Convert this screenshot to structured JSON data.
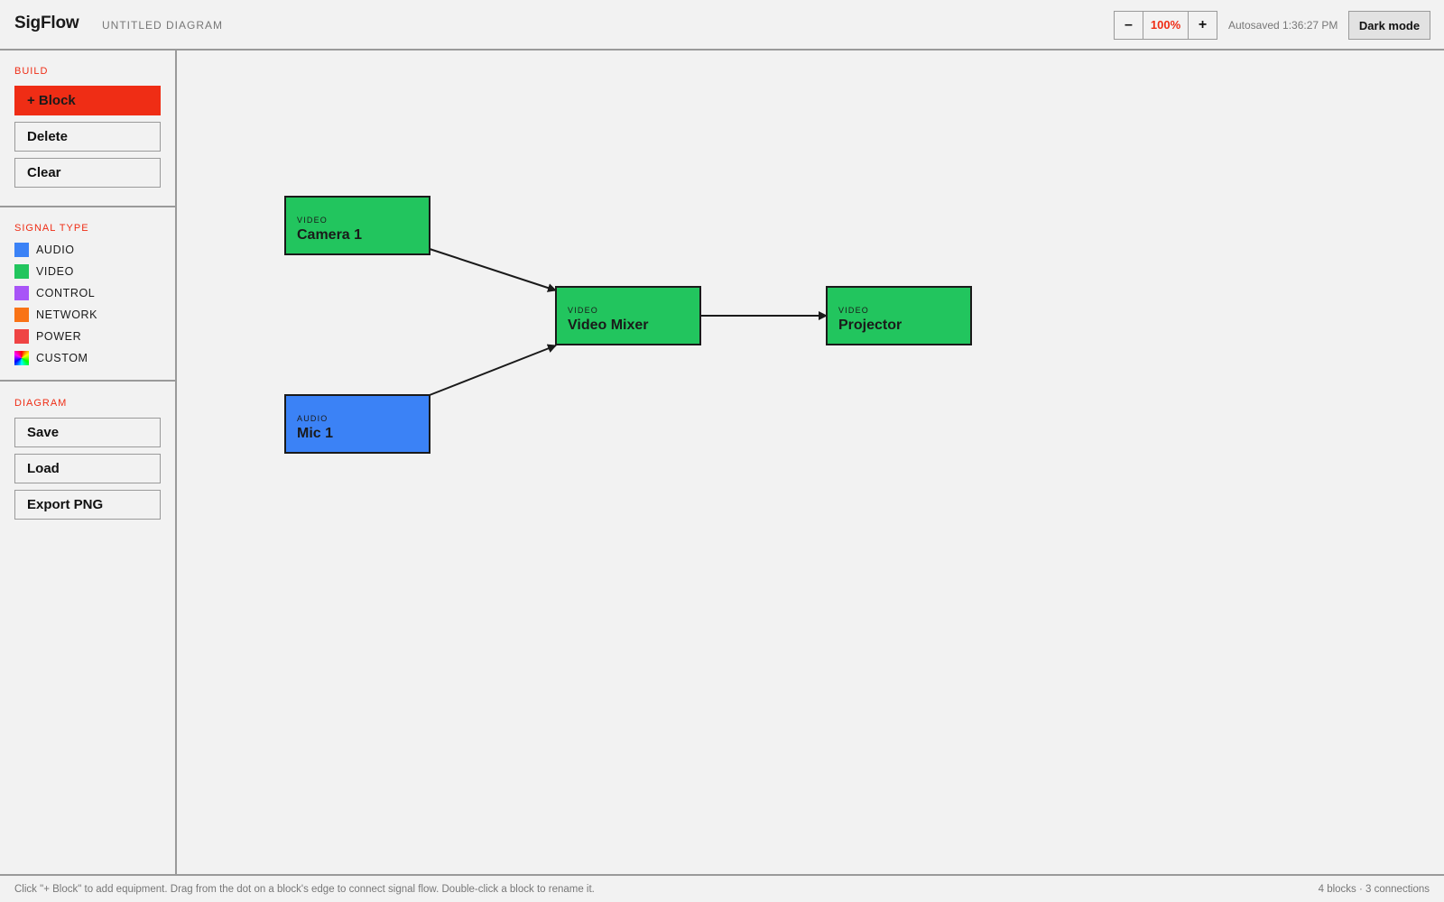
{
  "header": {
    "app_name": "SigFlow",
    "diagram_title": "UNTITLED DIAGRAM",
    "zoom_out_label": "–",
    "zoom_level": "100%",
    "zoom_in_label": "+",
    "autosave_text": "Autosaved 1:36:27 PM",
    "dark_mode_label": "Dark mode"
  },
  "sidebar": {
    "build": {
      "title": "BUILD",
      "add_block_label": "+ Block",
      "delete_label": "Delete",
      "clear_label": "Clear"
    },
    "signal_type": {
      "title": "SIGNAL TYPE",
      "items": [
        {
          "label": "AUDIO",
          "color": "#3b82f6"
        },
        {
          "label": "VIDEO",
          "color": "#22c55e"
        },
        {
          "label": "CONTROL",
          "color": "#a855f7"
        },
        {
          "label": "NETWORK",
          "color": "#f97316"
        },
        {
          "label": "POWER",
          "color": "#ef4444"
        },
        {
          "label": "CUSTOM",
          "color": "rainbow"
        }
      ]
    },
    "diagram": {
      "title": "DIAGRAM",
      "save_label": "Save",
      "load_label": "Load",
      "export_label": "Export PNG"
    }
  },
  "canvas": {
    "blocks": [
      {
        "id": "camera1",
        "type": "VIDEO",
        "name": "Camera 1",
        "color": "#22c55e"
      },
      {
        "id": "videomixer",
        "type": "VIDEO",
        "name": "Video Mixer",
        "color": "#22c55e"
      },
      {
        "id": "projector",
        "type": "VIDEO",
        "name": "Projector",
        "color": "#22c55e"
      },
      {
        "id": "mic1",
        "type": "AUDIO",
        "name": "Mic 1",
        "color": "#3b82f6"
      }
    ],
    "connections": [
      {
        "from": "Camera 1",
        "to": "Video Mixer"
      },
      {
        "from": "Mic 1",
        "to": "Video Mixer"
      },
      {
        "from": "Video Mixer",
        "to": "Projector"
      }
    ]
  },
  "footer": {
    "hint": "Click \"+ Block\" to add equipment. Drag from the dot on a block's edge to connect signal flow. Double-click a block to rename it.",
    "stats": "4 blocks · 3 connections"
  }
}
